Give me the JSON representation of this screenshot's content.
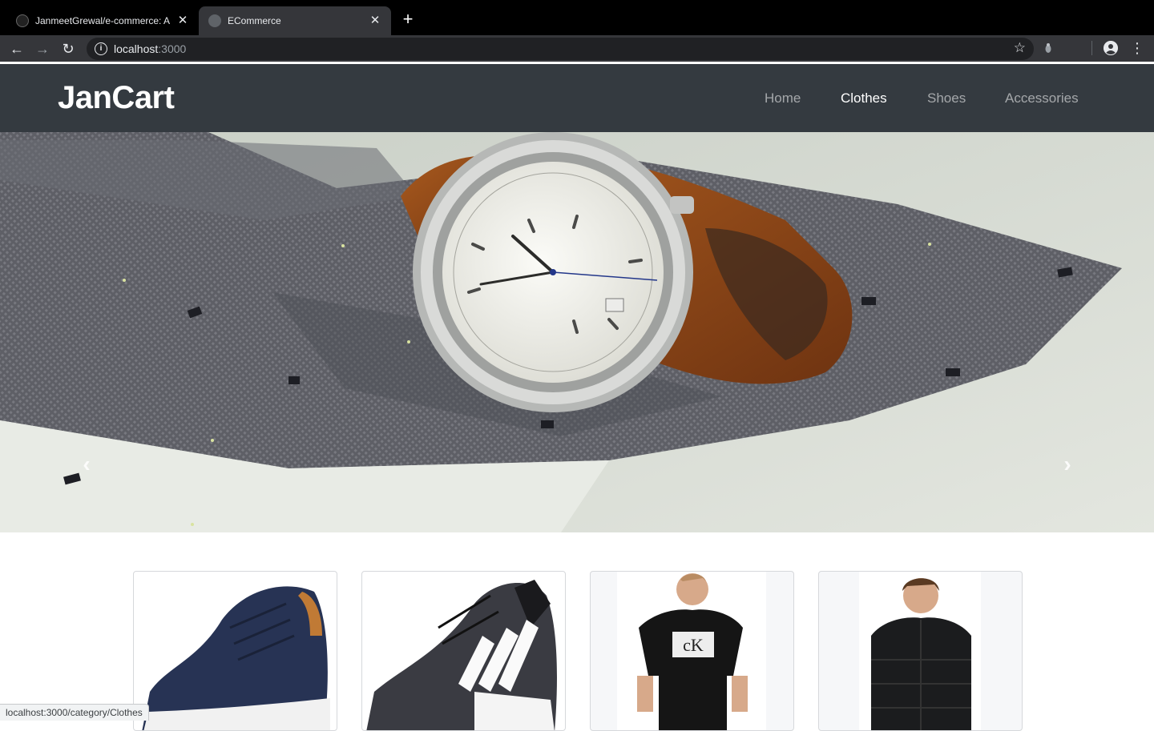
{
  "browser": {
    "tabs": [
      {
        "title": "JanmeetGrewal/e-commerce: A"
      },
      {
        "title": "ECommerce"
      }
    ],
    "url_host": "localhost",
    "url_port": ":3000",
    "status_url": "localhost:3000/category/Clothes"
  },
  "site": {
    "brand": "JanCart",
    "nav": [
      {
        "label": "Home",
        "active": false
      },
      {
        "label": "Clothes",
        "active": true
      },
      {
        "label": "Shoes",
        "active": false
      },
      {
        "label": "Accessories",
        "active": false
      }
    ]
  },
  "carousel": {
    "prev_icon": "chevron-left",
    "next_icon": "chevron-right"
  },
  "products": [
    {
      "image": "navy leather sneaker"
    },
    {
      "image": "black adidas running shoe"
    },
    {
      "image": "black Calvin Klein t-shirt"
    },
    {
      "image": "black puffer jacket"
    }
  ],
  "colors": {
    "navbar": "#343a40",
    "chrome_dark": "#35363a"
  }
}
